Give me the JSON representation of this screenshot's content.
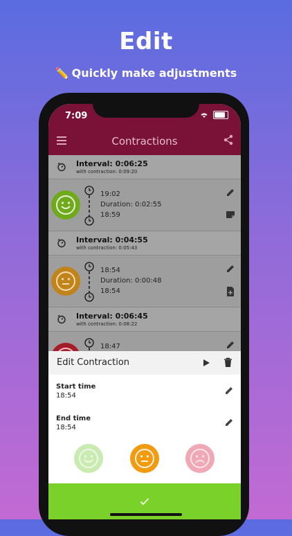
{
  "promo": {
    "headline": "Edit",
    "subline": "Quickly make adjustments",
    "subline_icon": "pencil-emoji"
  },
  "status_bar": {
    "time": "7:09"
  },
  "app_bar": {
    "title": "Contractions",
    "menu_icon": "hamburger-icon",
    "share_icon": "share-icon"
  },
  "list": {
    "intervals": [
      {
        "label": "Interval: 0:06:25",
        "sub": "with contraction: 0:09:20"
      },
      {
        "label": "Interval: 0:04:55",
        "sub": "with contraction: 0:05:43"
      },
      {
        "label": "Interval: 0:06:45",
        "sub": "with contraction: 0:08:22"
      }
    ],
    "entries": [
      {
        "start": "19:02",
        "duration": "Duration: 0:02:55",
        "end": "18:59",
        "mood": "happy",
        "color": "#7ab51f"
      },
      {
        "start": "18:54",
        "duration": "Duration: 0:00:48",
        "end": "18:54",
        "mood": "neutral",
        "color": "#c98a1a"
      },
      {
        "start": "18:47",
        "duration": "",
        "end": "",
        "mood": "sad",
        "color": "#b5222f"
      }
    ]
  },
  "sheet": {
    "title": "Edit Contraction",
    "start_label": "Start time",
    "start_value": "18:54",
    "end_label": "End time",
    "end_value": "18:54",
    "confirm_icon": "checkmark-icon"
  },
  "colors": {
    "appbar": "#7a1238",
    "happy": "#c9eab0",
    "neutral": "#f29a10",
    "sad": "#f0a8b6",
    "confirm": "#7ad12a"
  }
}
